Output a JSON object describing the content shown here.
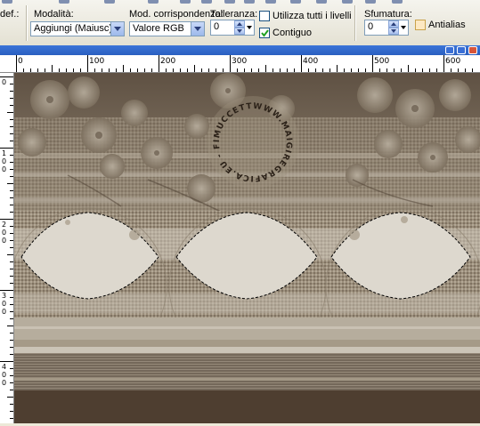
{
  "toolbar": {
    "preset_label": "def.:",
    "mode_label": "Modalità:",
    "mode_value": "Aggiungi (Maiusc)",
    "match_label": "Mod. corrispondenza:",
    "match_value": "Valore RGB",
    "tolerance_label": "Tolleranza:",
    "tolerance_value": "0",
    "use_all_layers_label": "Utilizza tutti i livelli",
    "use_all_layers_checked": false,
    "contiguous_label": "Contiguo",
    "contiguous_checked": true,
    "feather_label": "Sfumatura:",
    "feather_value": "0",
    "antialias_label": "Antialias",
    "antialias_checked": false
  },
  "rulers": {
    "horizontal_labels": [
      "0",
      "100",
      "200",
      "300",
      "400",
      "500",
      "600"
    ],
    "vertical_labels": [
      "0",
      "100",
      "200",
      "300",
      "400"
    ]
  },
  "image": {
    "watermark_text": "WWW.MAIGIREGRAFICA.EU - FIMUCCETTA -",
    "colors": {
      "dark": "#4e3e30",
      "mid": "#8a7d6c",
      "light": "#c8c1b3",
      "pale": "#ddd8ce"
    }
  }
}
